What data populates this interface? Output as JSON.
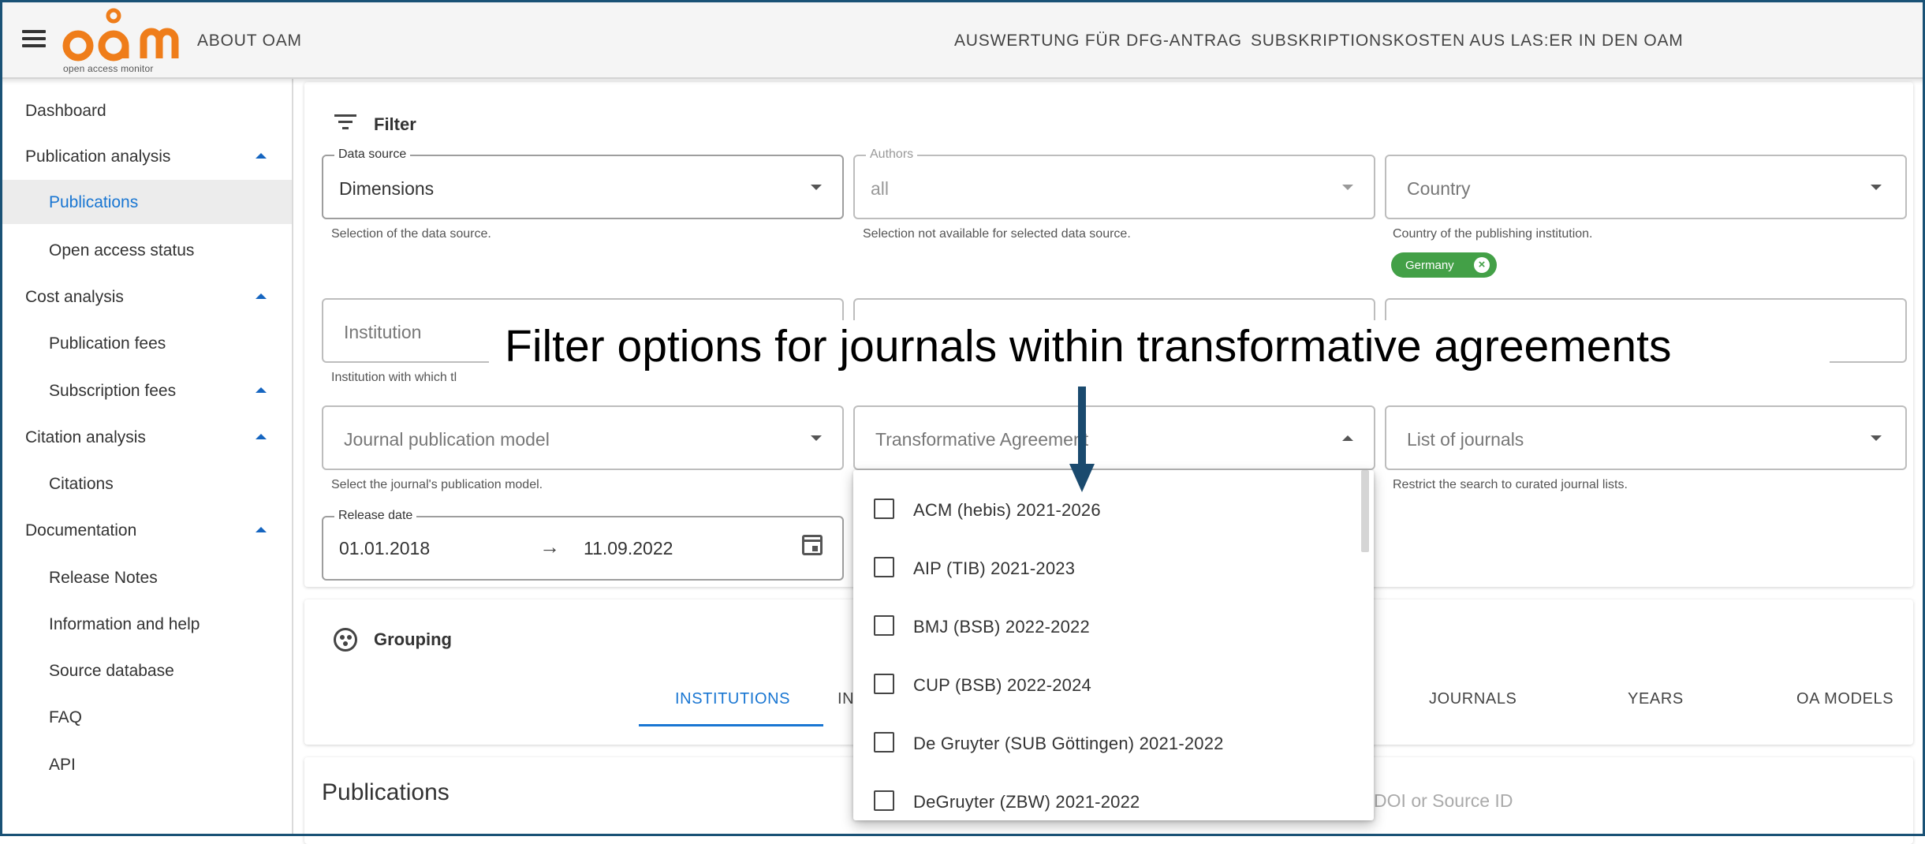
{
  "header": {
    "logo_text": "oam",
    "logo_tagline": "open access monitor",
    "about_label": "ABOUT OAM",
    "nav": [
      "AUSWERTUNG FÜR DFG-ANTRAG",
      "SUBSKRIPTIONSKOSTEN AUS LAS:ER IN DEN OAM"
    ]
  },
  "sidebar": {
    "items": [
      {
        "label": "Dashboard"
      },
      {
        "label": "Publication analysis"
      },
      {
        "label": "Publications"
      },
      {
        "label": "Open access status"
      },
      {
        "label": "Cost analysis"
      },
      {
        "label": "Publication fees"
      },
      {
        "label": "Subscription fees"
      },
      {
        "label": "Citation analysis"
      },
      {
        "label": "Citations"
      },
      {
        "label": "Documentation"
      },
      {
        "label": "Release Notes"
      },
      {
        "label": "Information and help"
      },
      {
        "label": "Source database"
      },
      {
        "label": "FAQ"
      },
      {
        "label": "API"
      }
    ]
  },
  "filter": {
    "title": "Filter",
    "data_source": {
      "legend": "Data source",
      "value": "Dimensions",
      "hint": "Selection of the data source."
    },
    "authors": {
      "legend": "Authors",
      "value": "all",
      "hint": "Selection not available for selected data source."
    },
    "country": {
      "placeholder": "Country",
      "hint": "Country of the publishing institution.",
      "chip": "Germany"
    },
    "institution": {
      "placeholder": "Institution",
      "hint": "Institution with which tl"
    },
    "journal_model": {
      "placeholder": "Journal publication model",
      "hint": "Select the journal's publication model."
    },
    "transformative": {
      "placeholder": "Transformative Agreement"
    },
    "journal_list": {
      "placeholder": "List of journals",
      "hint": "Restrict the search to curated journal lists."
    },
    "release_date": {
      "legend": "Release date",
      "from": "01.01.2018",
      "to": "11.09.2022"
    }
  },
  "dropdown": {
    "options": [
      "ACM (hebis) 2021-2026",
      "AIP (TIB) 2021-2023",
      "BMJ (BSB) 2022-2022",
      "CUP (BSB) 2022-2024",
      "De Gruyter (SUB Göttingen) 2021-2022",
      "DeGruyter (ZBW) 2021-2022"
    ]
  },
  "grouping": {
    "title": "Grouping",
    "tabs": [
      "INSTITUTIONS",
      "IN",
      "JOURNALS",
      "YEARS",
      "OA MODELS"
    ]
  },
  "publications": {
    "title": "Publications",
    "search_placeholder": "r DOI or Source ID"
  },
  "annotation": {
    "text": "Filter options for journals within transformative agreements",
    "arrow_color": "#1a4a6e"
  },
  "colors": {
    "accent": "#1976d2",
    "logo_orange": "#ef7d1a",
    "chip_green": "#43a047",
    "frame": "#1a5276"
  },
  "icons": [
    "menu-icon",
    "filter-icon",
    "chevron-down-icon",
    "chevron-up-icon",
    "close-icon",
    "calendar-icon",
    "grouping-icon",
    "checkbox-icon"
  ]
}
